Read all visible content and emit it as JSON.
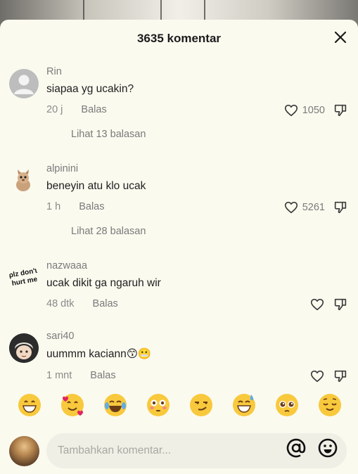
{
  "header": {
    "title": "3635 komentar"
  },
  "comments": [
    {
      "username": "Rin",
      "text": "siapaa yg ucakin?",
      "time": "20 j",
      "reply_label": "Balas",
      "likes": "1050",
      "view_replies": "Lihat 13 balasan"
    },
    {
      "username": "alpinini",
      "text": "beneyin atu klo ucak",
      "time": "1 h",
      "reply_label": "Balas",
      "likes": "5261",
      "view_replies": "Lihat 28 balasan"
    },
    {
      "username": "nazwaaa",
      "text": "ucak dikit ga ngaruh wir",
      "time": "48 dtk",
      "reply_label": "Balas",
      "likes": ""
    },
    {
      "username": "sari40",
      "text": "uummm kaciann😙😬",
      "time": "1 mnt",
      "reply_label": "Balas",
      "likes": ""
    }
  ],
  "avatars": {
    "comment_3_text": "plz don't hurt me"
  },
  "quick_emojis": [
    "😁",
    "🥰",
    "😂",
    "😳",
    "😏",
    "😅",
    "🥺",
    "😌"
  ],
  "composer": {
    "placeholder": "Tambahkan komentar..."
  },
  "icons": [
    "close-icon",
    "heart-icon",
    "dislike-icon",
    "at-icon",
    "emoji-icon"
  ],
  "colors": {
    "sheet_bg": "#fbfaef",
    "text": "#1e1e1e",
    "muted": "#8a8a8a"
  }
}
